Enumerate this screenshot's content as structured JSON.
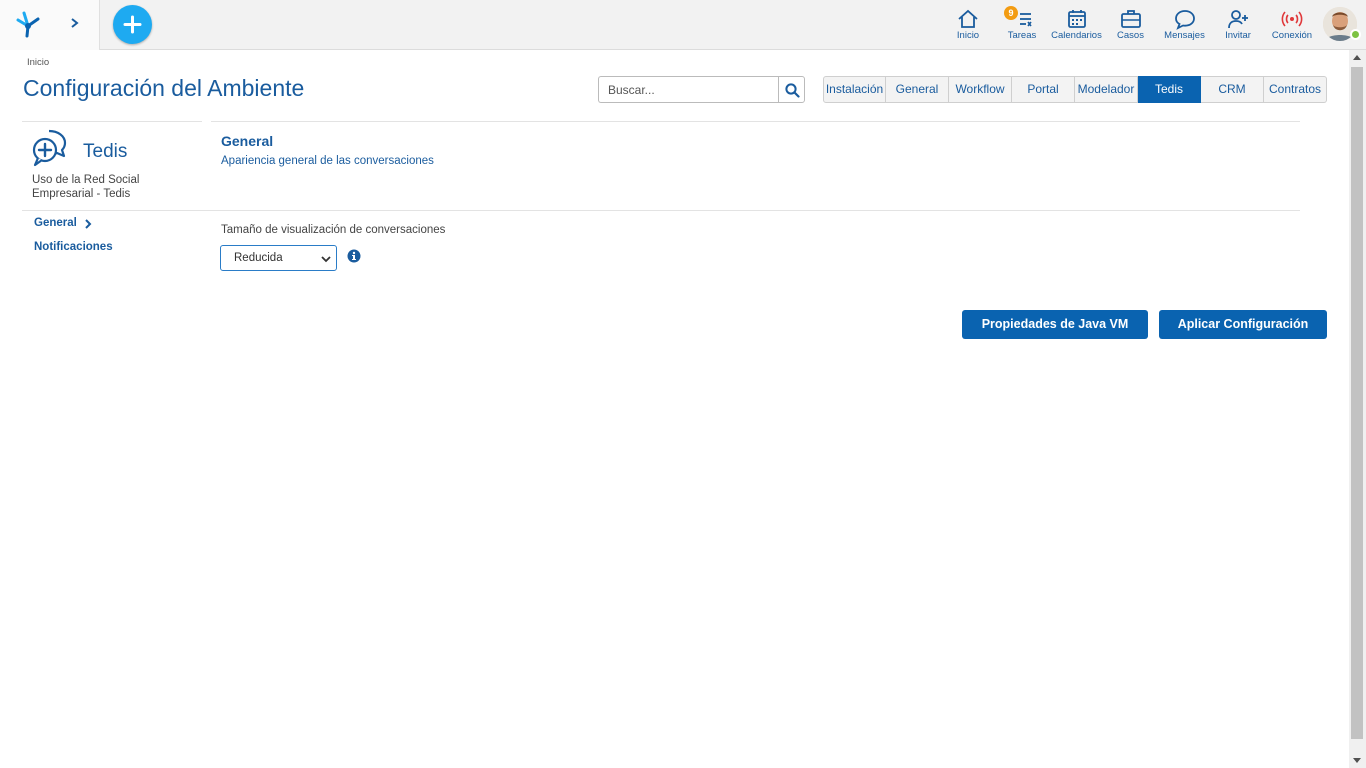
{
  "topbar": {
    "nav": [
      {
        "label": "Inicio",
        "icon": "home-icon"
      },
      {
        "label": "Tareas",
        "icon": "tasks-icon",
        "badge": "9"
      },
      {
        "label": "Calendarios",
        "icon": "calendar-icon"
      },
      {
        "label": "Casos",
        "icon": "briefcase-icon"
      },
      {
        "label": "Mensajes",
        "icon": "chat-icon"
      },
      {
        "label": "Invitar",
        "icon": "invite-icon"
      },
      {
        "label": "Conexión",
        "icon": "connection-icon"
      }
    ],
    "colors": {
      "accent": "#1eaaf1",
      "badge": "#f39c12",
      "connection": "#e0383a",
      "online": "#7dc243"
    }
  },
  "header": {
    "breadcrumb": "Inicio",
    "title": "Configuración del Ambiente",
    "search_placeholder": "Buscar..."
  },
  "tabs": [
    {
      "label": "Instalación",
      "active": false
    },
    {
      "label": "General",
      "active": false
    },
    {
      "label": "Workflow",
      "active": false
    },
    {
      "label": "Portal",
      "active": false
    },
    {
      "label": "Modelador",
      "active": false
    },
    {
      "label": "Tedis",
      "active": true
    },
    {
      "label": "CRM",
      "active": false
    },
    {
      "label": "Contratos",
      "active": false
    }
  ],
  "sidebar": {
    "title": "Tedis",
    "description": "Uso de la Red Social Empresarial - Tedis",
    "items": [
      {
        "label": "General",
        "active": true
      },
      {
        "label": "Notificaciones",
        "active": false
      }
    ]
  },
  "main": {
    "section_title": "General",
    "section_subtitle": "Apariencia general de las conversaciones",
    "field_label": "Tamaño de visualización de conversaciones",
    "select_value": "Reducida",
    "buttons": {
      "java_vm": "Propiedades de Java VM",
      "apply": "Aplicar Configuración"
    }
  },
  "theme": {
    "primary": "#0a63b0",
    "text_blue": "#1a5c9e"
  }
}
